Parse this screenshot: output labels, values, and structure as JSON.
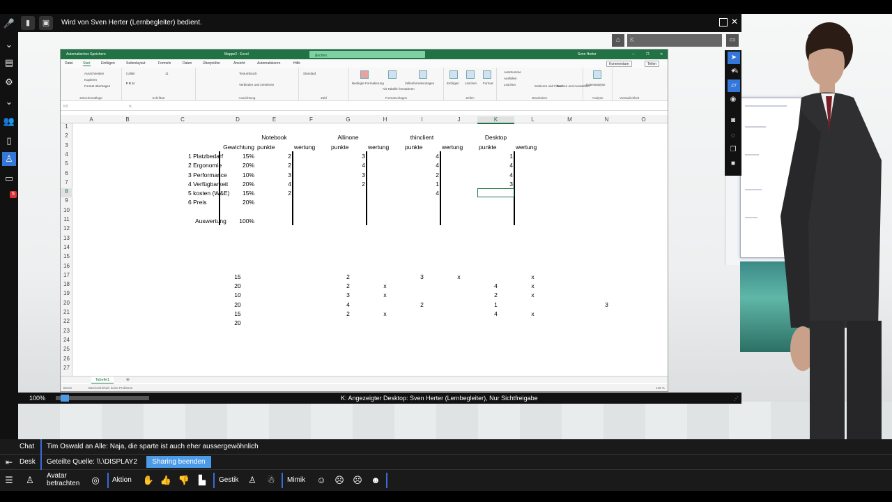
{
  "topbar": {
    "title": "Wird von Sven Herter (Lernbegleiter) bedient."
  },
  "navbar": {
    "address": "K"
  },
  "leftbar": {
    "badge": "5"
  },
  "excel": {
    "title_left": "Automatisches Speichern",
    "title_center": "Mappe2 - Excel",
    "title_user": "Sven Herter",
    "search_placeholder": "Suchen",
    "menu": [
      "Datei",
      "Start",
      "Einfügen",
      "Seitenlayout",
      "Formeln",
      "Daten",
      "Überprüfen",
      "Ansicht",
      "Automatisieren",
      "Hilfe"
    ],
    "comment_btn": "Kommentare",
    "share_btn": "Teilen",
    "ribbon": {
      "clip_labels": [
        "Ausschneiden",
        "Kopieren",
        "Format übertragen"
      ],
      "clip_group": "Zwischenablage",
      "font_name": "Calibri",
      "font_size": "11",
      "font_group": "Schriftart",
      "wrap": "Textumbruch",
      "merge": "Verbinden und zentrieren",
      "align_group": "Ausrichtung",
      "numfmt": "Standard",
      "number_group": "Zahl",
      "styles": [
        "Bedingte Formatierung",
        "Als Tabelle formatieren",
        "Zellenformatvorlagen"
      ],
      "styles_group": "Formatvorlagen",
      "cells": [
        "Einfügen",
        "Löschen",
        "Format"
      ],
      "cells_group": "Zellen",
      "edit": [
        "AutoSumme",
        "Ausfüllen",
        "Löschen",
        "Sortieren und Filtern",
        "Suchen und Auswählen"
      ],
      "edit_group": "Bearbeiten",
      "analyze": "Datenanalyse",
      "analyze_group": "Analyse",
      "sensitivity": "Vertraulichkeit"
    },
    "namebox": "K8",
    "fx": "fx",
    "columns": [
      "A",
      "B",
      "C",
      "D",
      "E",
      "F",
      "G",
      "H",
      "I",
      "J",
      "K",
      "L",
      "M",
      "N",
      "O"
    ],
    "selected_column": "K",
    "rows": [
      "1",
      "2",
      "3",
      "4",
      "5",
      "6",
      "7",
      "8",
      "9",
      "10",
      "11",
      "12",
      "13",
      "14",
      "15",
      "16",
      "17",
      "18",
      "19",
      "20",
      "21",
      "22",
      "23",
      "24",
      "25",
      "26",
      "27"
    ],
    "selected_row": "8",
    "headers": {
      "notebook": "Notebook",
      "allinone": "Allinone",
      "thinclient": "thinclient",
      "desktop": "Desktop",
      "gewichtung": "Gewichtung",
      "punkte": "punkte",
      "wertung": "wertung"
    },
    "criteria": [
      "1 Platzbedarf",
      "2 Ergonomie",
      "3 Performance",
      "4 Verfügbarkeit",
      "5 kosten (W&E)",
      "6 Preis"
    ],
    "weights": [
      "15%",
      "20%",
      "10%",
      "20%",
      "15%",
      "20%"
    ],
    "auswertung": "Auswertung",
    "auswertung_total": "100%",
    "notebook_pts": [
      "2",
      "2",
      "3",
      "4",
      "2",
      ""
    ],
    "allinone_pts": [
      "3",
      "4",
      "3",
      "2",
      "",
      ""
    ],
    "thin_pts": [
      "4",
      "4",
      "2",
      "1",
      "4",
      ""
    ],
    "desktop_pts": [
      "1",
      "4",
      "4",
      "3",
      "",
      ""
    ],
    "lower": {
      "d": [
        "15",
        "20",
        "10",
        "20",
        "15",
        "20"
      ],
      "g": [
        "2",
        "2",
        "3",
        "4",
        "2",
        ""
      ],
      "h": [
        "",
        "x",
        "x",
        "",
        "x",
        ""
      ],
      "i": [
        "3",
        "",
        "",
        "2",
        "",
        ""
      ],
      "j": [
        "x",
        "",
        "",
        "",
        "",
        ""
      ],
      "k": [
        "",
        "4",
        "2",
        "1",
        "4",
        ""
      ],
      "l": [
        "x",
        "x",
        "x",
        "",
        "x",
        ""
      ],
      "n": [
        "",
        "",
        "",
        "3",
        "",
        ""
      ]
    },
    "sheet": "Tabelle1",
    "status_left": "Bereit",
    "status_access": "Barrierefreiheit: keine Probleme",
    "status_zoom": "145 %"
  },
  "window_status": {
    "zoom": "100%",
    "desc": "K: Angezeigter Desktop: Sven Herter (Lernbegleiter), Nur Sichtfreigabe",
    "zoom_level": 0.05
  },
  "bottom": {
    "chat_label": "Chat",
    "chat_msg": "Tim Oswald an Alle: Naja, die sparte ist auch eher aussergewöhnlich",
    "desk_label": "Desk",
    "source": "Geteilte Quelle: \\\\.\\DISPLAY2",
    "sharing_end": "Sharing beenden",
    "avatar": "Avatar betrachten",
    "aktion": "Aktion",
    "gestik": "Gestik",
    "mimik": "Mimik"
  }
}
